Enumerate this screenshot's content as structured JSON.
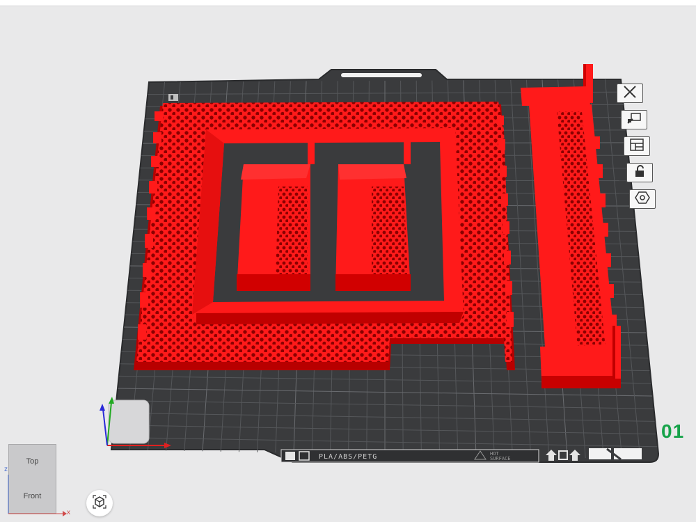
{
  "plate": {
    "material_label": "PLA/ABS/PETG",
    "hot_surface_line1": "HOT",
    "hot_surface_line2": "SURFACE",
    "number": "01"
  },
  "view_cube": {
    "top_label": "Top",
    "front_label": "Front",
    "axis_z": "z",
    "axis_x": "x"
  },
  "toolbar": {
    "items": [
      {
        "icon": "close-icon"
      },
      {
        "icon": "auto-orient-icon"
      },
      {
        "icon": "arrange-icon"
      },
      {
        "icon": "unlock-icon"
      },
      {
        "icon": "settings-hex-icon"
      }
    ]
  },
  "colors": {
    "background": "#e9e9ea",
    "plate": "#3a3b3d",
    "grid": "#55575a",
    "model": "#ff1a1a",
    "model_dark": "#b50000",
    "accent": "#17a34a"
  }
}
